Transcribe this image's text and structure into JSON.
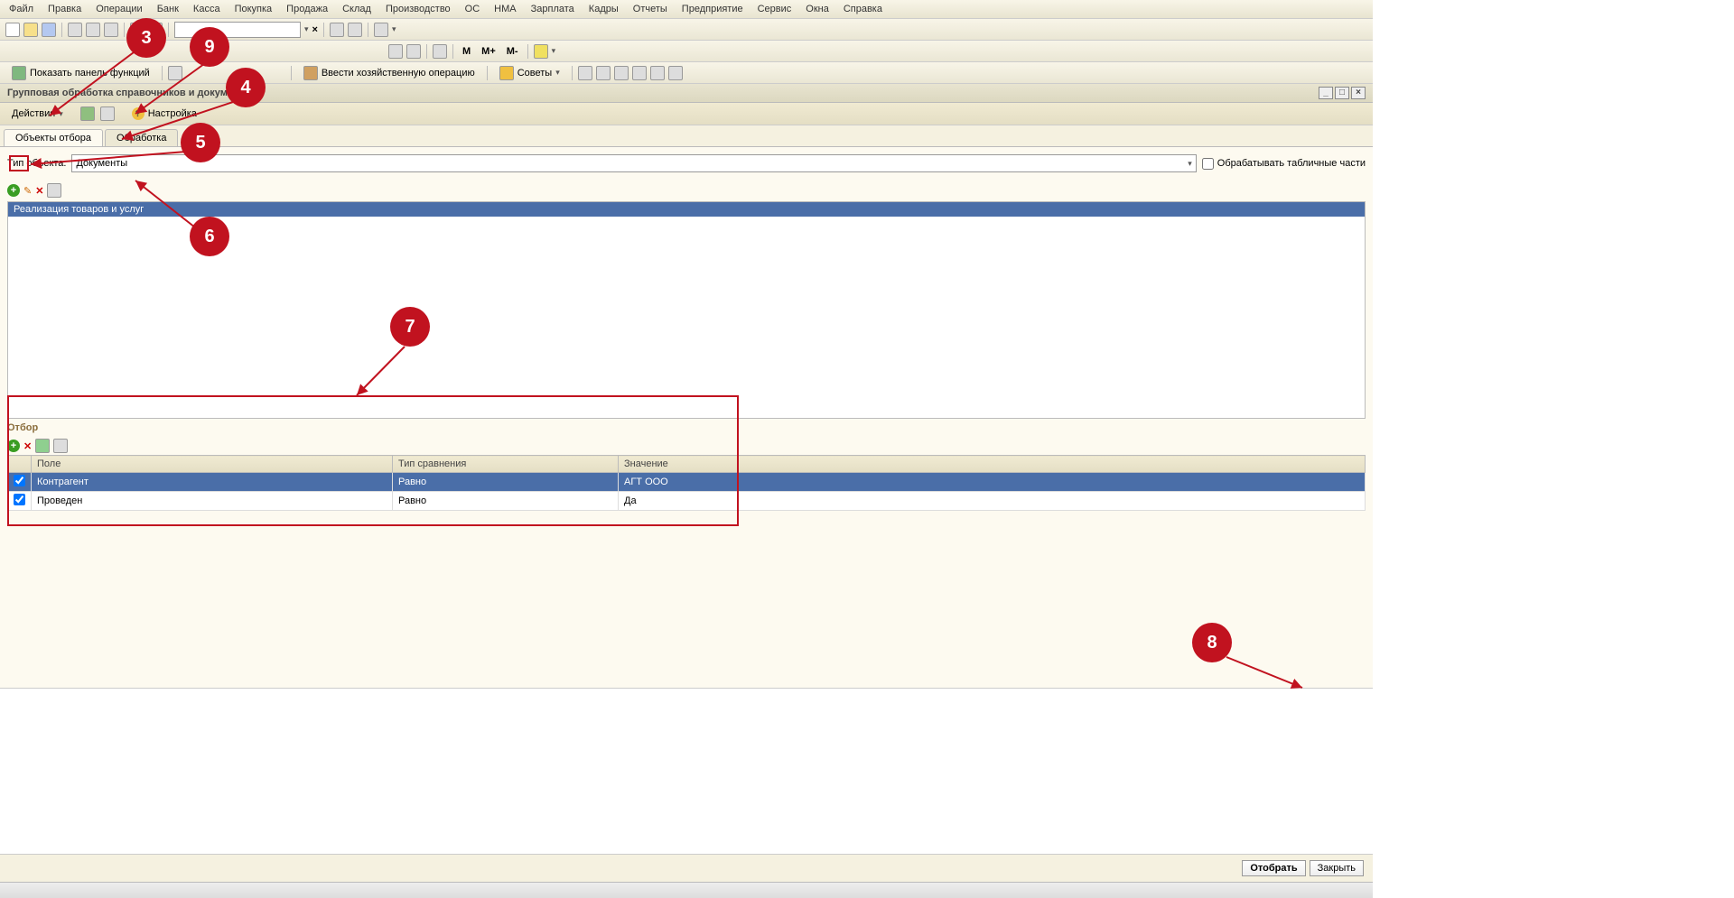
{
  "menu": [
    "Файл",
    "Правка",
    "Операции",
    "Банк",
    "Касса",
    "Покупка",
    "Продажа",
    "Склад",
    "Производство",
    "ОС",
    "НМА",
    "Зарплата",
    "Кадры",
    "Отчеты",
    "Предприятие",
    "Сервис",
    "Окна",
    "Справка"
  ],
  "toolbar1": {
    "clear_x": "×"
  },
  "toolbar2": {
    "m": "M",
    "mplus": "M+",
    "mminus": "M-"
  },
  "toolbar3": {
    "show_panel": "Показать панель функций",
    "vvesti_op": "Ввести хозяйственную операцию",
    "sovety": "Советы"
  },
  "window": {
    "title": "Групповая обработка справочников и документов"
  },
  "subtool": {
    "actions": "Действия",
    "settings": "Настройка"
  },
  "tabs": {
    "t1": "Объекты отбора",
    "t2": "Обработка"
  },
  "type_row": {
    "label": "Тип объекта:",
    "value": "Документы",
    "checkbox": "Обрабатывать табличные части"
  },
  "obj_list": {
    "row1": "Реализация товаров и услуг"
  },
  "filter": {
    "title": "Отбор",
    "col1": "Поле",
    "col2": "Тип сравнения",
    "col3": "Значение",
    "rows": [
      {
        "checked": true,
        "field": "Контрагент",
        "cmp": "Равно",
        "val": "АГТ ООО"
      },
      {
        "checked": true,
        "field": "Проведен",
        "cmp": "Равно",
        "val": "Да"
      }
    ]
  },
  "bottom": {
    "select": "Отобрать",
    "close": "Закрыть"
  },
  "annotations": {
    "a3": "3",
    "a4": "4",
    "a5": "5",
    "a6": "6",
    "a7": "7",
    "a8": "8",
    "a9": "9"
  }
}
